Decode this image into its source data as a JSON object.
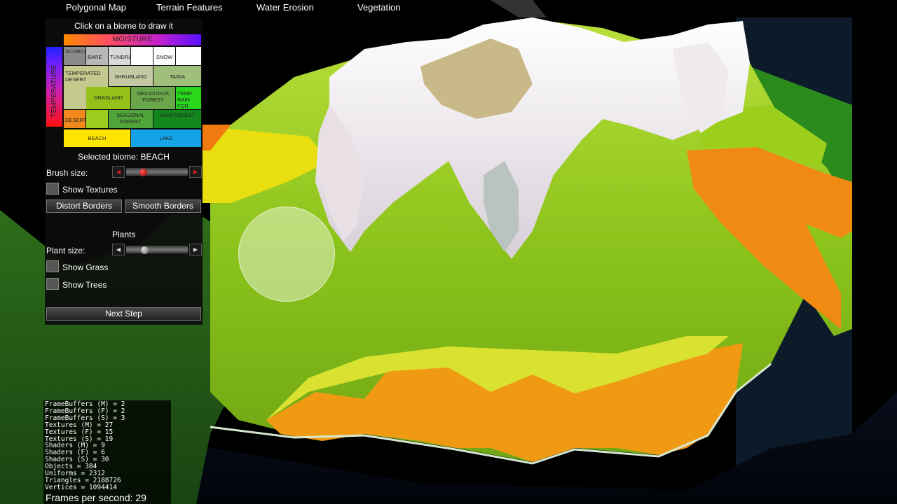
{
  "menu": {
    "polygonal_map": "Polygonal Map",
    "terrain_features": "Terrain Features",
    "water_erosion": "Water Erosion",
    "vegetation": "Vegetation"
  },
  "panel": {
    "title": "Click on a biome to draw it",
    "moisture_label": "MOISTURE",
    "temperature_label": "TEMPERATURE",
    "biomes": {
      "scorched": "SCORCHED",
      "bare": "BARE",
      "tundra": "TUNDRA",
      "snow": "SNOW",
      "temperate_desert": "TEMPERATED DESERT",
      "shrubland": "SHRUBLAND",
      "taiga": "TAIGA",
      "grassland": "GRASLAND",
      "deciduous_forest": "DECIDUOUS FOREST",
      "temperate_rain_forest": "TEMP. RAIN FOR.",
      "desert": "DESERT",
      "seasonal_forest": "SEASONAL FOREST",
      "rain_forest": "RAIN FOREST",
      "beach": "BEACH",
      "lake": "LAKE"
    },
    "selected_biome": "Selected biome: BEACH",
    "brush_size_label": "Brush size:",
    "show_textures": "Show Textures",
    "distort_borders": "Distort Borders",
    "smooth_borders": "Smooth Borders",
    "plants_heading": "Plants",
    "plant_size_label": "Plant size:",
    "show_grass": "Show Grass",
    "show_trees": "Show Trees",
    "next_step": "Next Step",
    "brush_size_value": 0.25,
    "plant_size_value": 0.27
  },
  "stats": {
    "lines": [
      "FrameBuffers (M) = 2",
      "FrameBuffers (F) = 2",
      "FrameBuffers (S) = 3",
      "Textures (M) = 27",
      "Textures (F) = 15",
      "Textures (S) = 19",
      "Shaders (M) = 9",
      "Shaders (F) = 6",
      "Shaders (S) = 30",
      "Objects = 384",
      "Uniforms = 2312",
      "Triangles = 2188726",
      "Vertices = 1094414"
    ],
    "fps": "Frames per second: 29"
  },
  "colors": {
    "snow": "#f2f2f2",
    "tundra": "#dcdcdc",
    "bare": "#bbbbbb",
    "scorched": "#999999",
    "temperate_desert": "#c9d29b",
    "shrubland": "#c4ccbb",
    "taiga": "#99ab77",
    "grassland": "#88aa55",
    "deciduous_forest": "#679459",
    "temperate_rain_forest": "#22cc11",
    "desert": "#f28a1a",
    "seasonal_forest": "#559944",
    "rain_forest": "#117722",
    "beach": "#ffe000",
    "lake": "#16a2e6"
  }
}
